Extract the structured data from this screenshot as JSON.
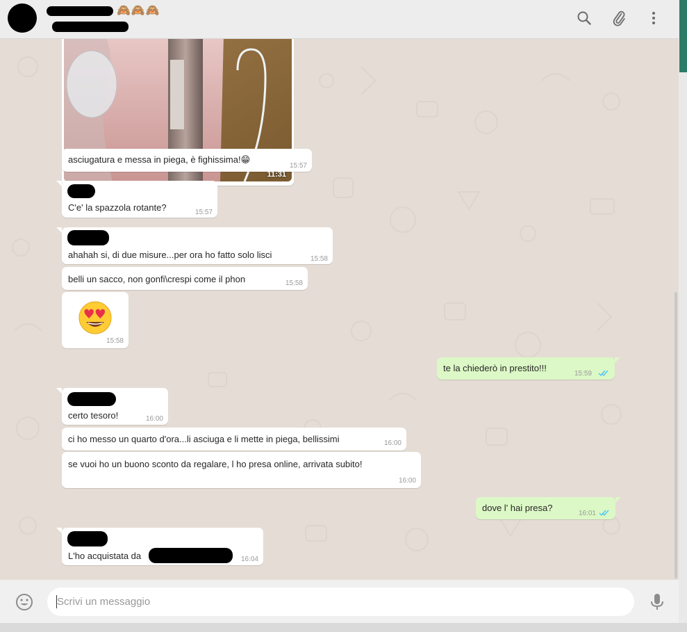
{
  "header": {
    "name_emoji": "🙈🙈🙈",
    "icons": [
      "search-icon",
      "attach-icon",
      "menu-icon"
    ]
  },
  "image_message": {
    "time": "11:31"
  },
  "messages": [
    {
      "text": "asciugatura e messa in piega, è fighissima!😁",
      "time": "15:57"
    },
    {
      "text": "C'e' la spazzola rotante?",
      "time": "15:57"
    },
    {
      "text": "ahahah si, di due misure...per ora ho fatto solo lisci",
      "time": "15:58"
    },
    {
      "text": "belli un sacco, non gonfi\\crespi come il phon",
      "time": "15:58"
    },
    {
      "emoji": "😍",
      "time": "15:58"
    },
    {
      "text": "te la chiederò in prestito!!!",
      "time": "15:59"
    },
    {
      "text": "certo tesoro!",
      "time": "16:00"
    },
    {
      "text": "ci ho messo un quarto d'ora...li asciuga e li mette in piega, bellissimi",
      "time": "16:00"
    },
    {
      "text": "se vuoi ho un buono sconto da regalare, l ho presa online, arrivata subito!",
      "time": "16:00"
    },
    {
      "text": "dove l' hai presa?",
      "time": "16:01"
    },
    {
      "text": "L'ho acquistata da",
      "time": "16:04"
    }
  ],
  "composer": {
    "placeholder": "Scrivi un messaggio",
    "icons": [
      "smiley-icon",
      "microphone-icon"
    ]
  },
  "colors": {
    "chat_background": "#e5ddd5",
    "incoming_bubble": "#ffffff",
    "outgoing_bubble": "#dcf8c6",
    "read_ticks": "#4fc3f7",
    "header": "#ededed",
    "accent": "#2b7b67"
  }
}
